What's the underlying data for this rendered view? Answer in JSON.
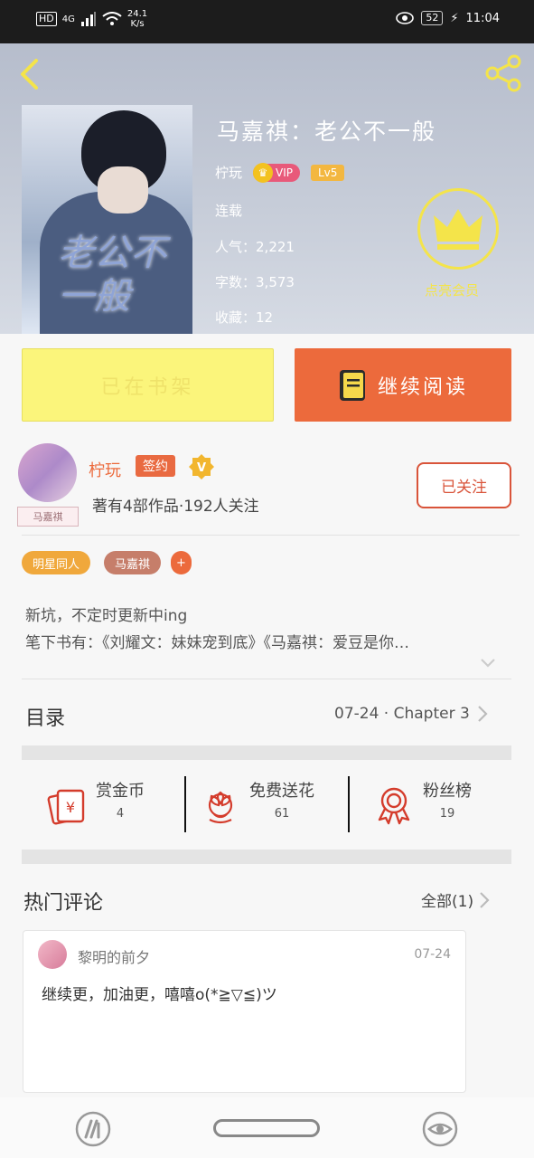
{
  "status_bar": {
    "hd": "HD",
    "network": "4G",
    "speed_value": "24.1",
    "speed_unit": "K/s",
    "battery": "52",
    "time": "11:04"
  },
  "header": {
    "back_icon": "back-arrow-icon",
    "share_icon": "share-icon"
  },
  "book": {
    "cover_title": "老公不一般",
    "title": "马嘉祺：老公不一般",
    "author": "柠玩",
    "vip_label": "VIP",
    "level": "Lv5",
    "status": "连载",
    "popularity_label": "人气：",
    "popularity": "2,221",
    "words_label": "字数：",
    "words": "3,573",
    "favorites_label": "收藏：",
    "favorites": "12",
    "member_label": "点亮会员"
  },
  "actions": {
    "shelf_label": "已在书架",
    "read_label": "继续阅读"
  },
  "author_panel": {
    "avatar_tag": "马嘉祺",
    "name": "柠玩",
    "sign_badge": "签约",
    "verified_badge": "V",
    "stats": "著有4部作品·192人关注",
    "follow_label": "已关注"
  },
  "tags": [
    "明星同人",
    "马嘉祺"
  ],
  "tag_add": "+",
  "description": {
    "line1": "新坑，不定时更新中ing",
    "line2": "笔下书有：《刘耀文：妹妹宠到底》《马嘉祺：爱豆是你…"
  },
  "toc": {
    "label": "目录",
    "latest": "07-24 · Chapter 3"
  },
  "stats": [
    {
      "label": "赏金币",
      "value": "4",
      "icon": "red-envelope-icon"
    },
    {
      "label": "免费送花",
      "value": "61",
      "icon": "flower-icon"
    },
    {
      "label": "粉丝榜",
      "value": "19",
      "icon": "award-ribbon-icon"
    }
  ],
  "comments": {
    "title": "热门评论",
    "all_label": "全部(1)",
    "items": [
      {
        "user": "黎明的前夕",
        "date": "07-24",
        "text": "继续更，加油更，嘻嘻o(*≧▽≦)ツ"
      }
    ]
  },
  "colors": {
    "accent": "#ec6a3c",
    "shelf_button": "#fbf57b",
    "member_gold": "#f4e44a"
  }
}
